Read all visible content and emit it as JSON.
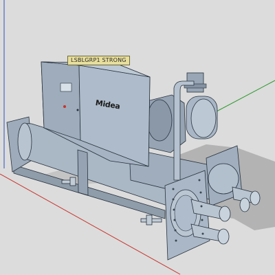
{
  "viewport": {
    "background": "#dcdcdc",
    "axes": {
      "red": "#c8332b",
      "green": "#2f9a2f",
      "blue": "#2d4fbf"
    }
  },
  "model": {
    "tag_label": "LSBLGRP1 STRONG",
    "brand_name": "Midea",
    "body_color": "#a7b4c3",
    "edge_color": "#27313c",
    "shadow_color": "#b6b6b6",
    "icons": [
      "control-cabinet",
      "compressor-motor",
      "oil-separator",
      "evaporator-shell",
      "condenser-shell",
      "water-nozzle",
      "flanged-end-cover"
    ]
  }
}
